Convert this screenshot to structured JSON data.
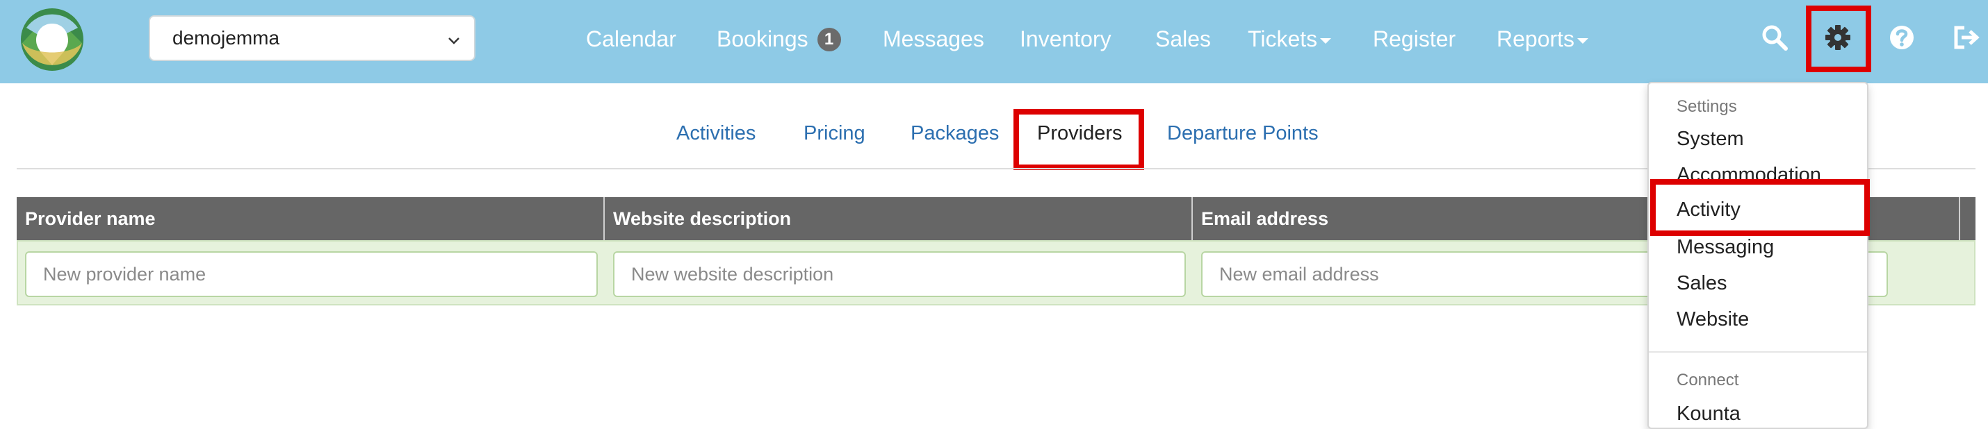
{
  "topbar": {
    "tenant": "demojemma",
    "nav": [
      {
        "label": "Calendar"
      },
      {
        "label": "Bookings",
        "badge": "1"
      },
      {
        "label": "Messages"
      },
      {
        "label": "Inventory"
      },
      {
        "label": "Sales"
      },
      {
        "label": "Tickets",
        "has_caret": true
      },
      {
        "label": "Register"
      },
      {
        "label": "Reports",
        "has_caret": true
      }
    ],
    "icons": [
      "search-icon",
      "gear-icon",
      "help-icon",
      "logout-icon"
    ]
  },
  "tabs": [
    {
      "label": "Activities"
    },
    {
      "label": "Pricing"
    },
    {
      "label": "Packages"
    },
    {
      "label": "Providers",
      "active": true
    },
    {
      "label": "Departure Points"
    }
  ],
  "table": {
    "columns": [
      "Provider name",
      "Website description",
      "Email address"
    ],
    "new_row_placeholders": {
      "provider_name": "New provider name",
      "website_description": "New website description",
      "email_address": "New email address"
    }
  },
  "settings_menu": {
    "header": "Settings",
    "items": [
      "System",
      "Accommodation",
      "Activity",
      "Messaging",
      "Sales",
      "Website"
    ],
    "connect_header": "Connect",
    "connect_items": [
      "Kounta"
    ]
  },
  "colors": {
    "topbar": "#8ecae6",
    "highlight": "#dd0000",
    "link": "#2c6fb0",
    "table_header": "#666666",
    "new_row": "#e6f2dc"
  }
}
